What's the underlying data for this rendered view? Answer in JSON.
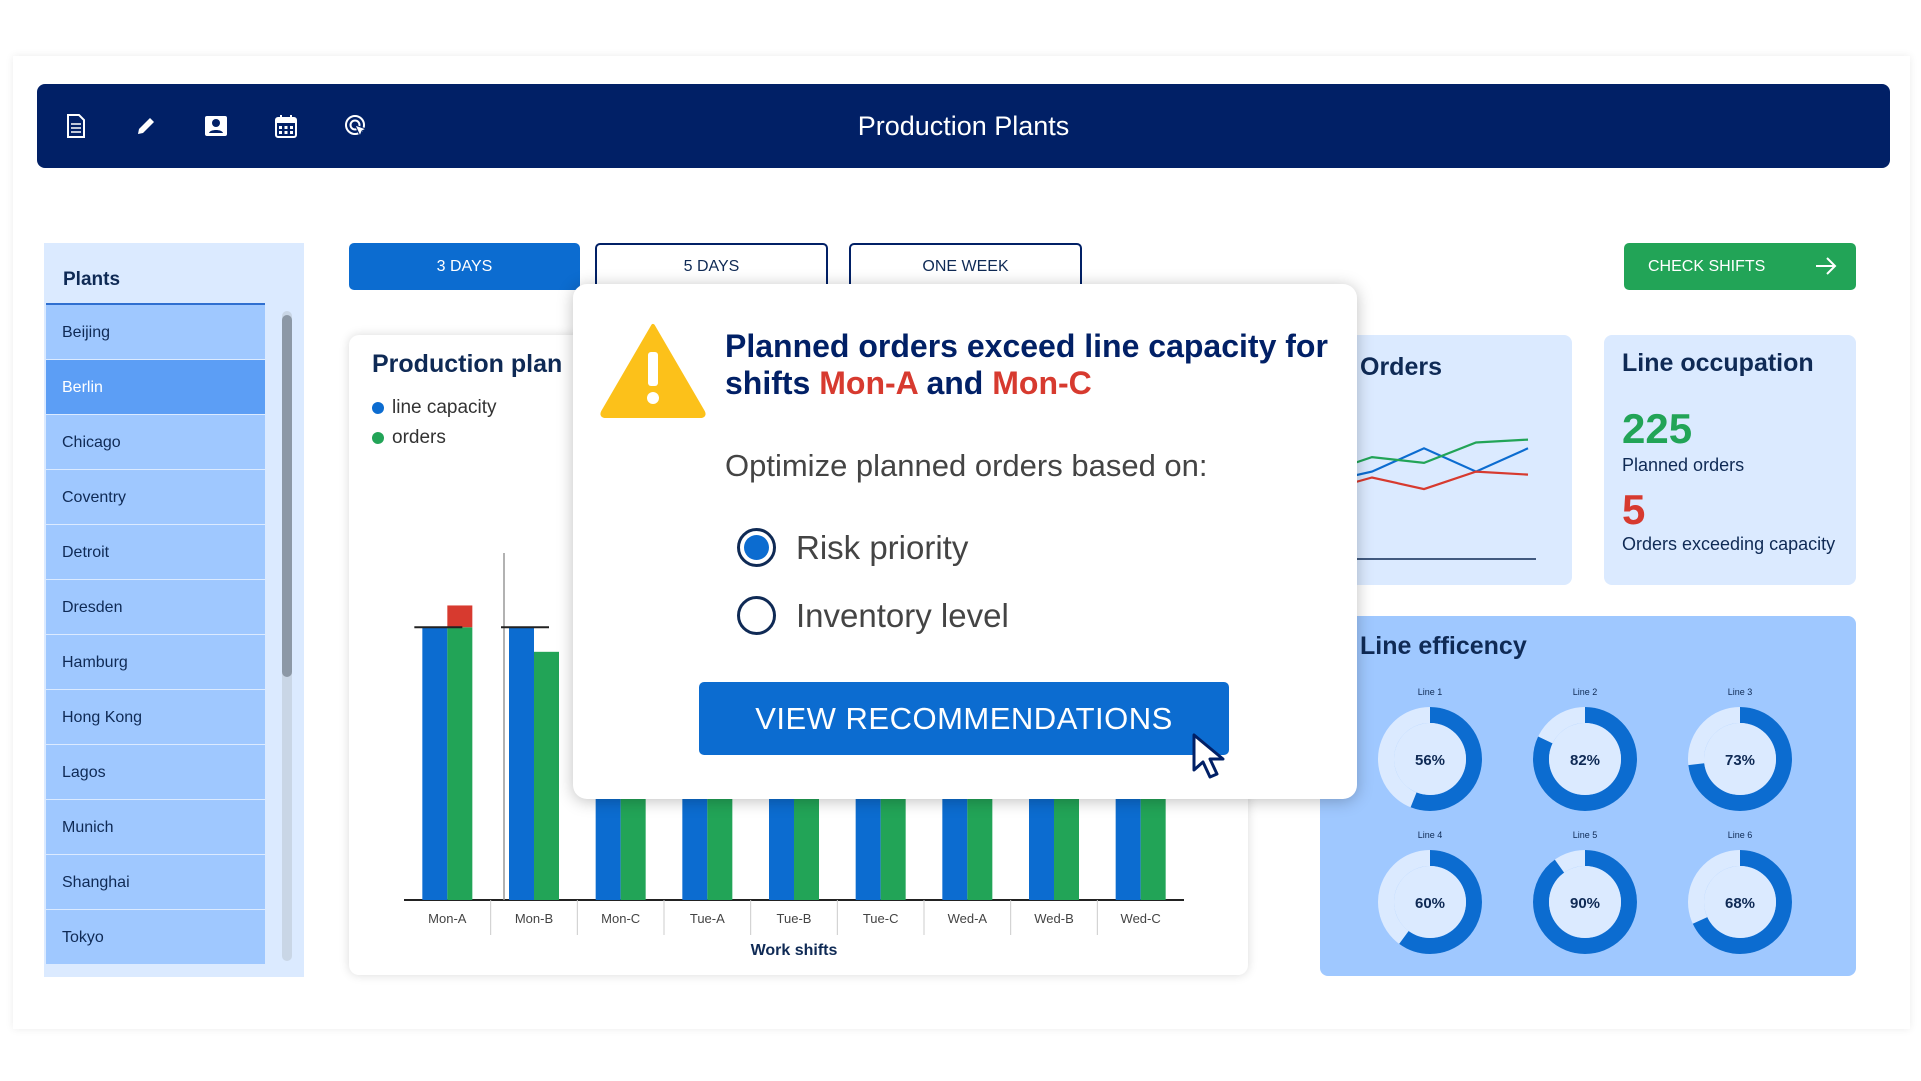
{
  "header": {
    "title": "Production Plants",
    "icons": [
      "document-icon",
      "pencil-icon",
      "contact-card-icon",
      "calendar-icon",
      "target-click-icon"
    ]
  },
  "sidebar": {
    "title": "Plants",
    "items": [
      "Beijing",
      "Berlin",
      "Chicago",
      "Coventry",
      "Detroit",
      "Dresden",
      "Hamburg",
      "Hong Kong",
      "Lagos",
      "Munich",
      "Shanghai",
      "Tokyo"
    ],
    "selected": "Berlin"
  },
  "range_tabs": {
    "three_days": "3 DAYS",
    "five_days": "5 DAYS",
    "one_week": "ONE WEEK",
    "active": "3 DAYS"
  },
  "check_shifts": {
    "label": "CHECK SHIFTS"
  },
  "production_card": {
    "title": "Production plan",
    "legend": {
      "capacity": "line capacity",
      "orders": "orders"
    },
    "xlabel": "Work shifts"
  },
  "orders_card": {
    "title": "Orders"
  },
  "occupation_card": {
    "title": "Line occupation",
    "planned_value": "225",
    "planned_label": "Planned orders",
    "exceeding_value": "5",
    "exceeding_label": "Orders exceeding capacity"
  },
  "efficiency_card": {
    "title": "Line efficency"
  },
  "modal": {
    "title_part1": "Planned orders exceed line capacity for shifts ",
    "shift_a": "Mon-A",
    "title_and": " and ",
    "shift_b": "Mon-C",
    "subtitle": "Optimize planned orders based on:",
    "option_risk": "Risk priority",
    "option_inventory": "Inventory level",
    "selected_option": "Risk priority",
    "button_label": "VIEW RECOMMENDATIONS"
  },
  "colors": {
    "navy": "#012066",
    "blue": "#0c6cd0",
    "green": "#22a457",
    "red": "#d73a2f",
    "light_blue": "#dbeaff",
    "mid_blue": "#9fc8ff"
  },
  "chart_data": [
    {
      "type": "bar",
      "title": "Production plan",
      "xlabel": "Work shifts",
      "categories": [
        "Mon-A",
        "Mon-B",
        "Mon-C",
        "Tue-A",
        "Tue-B",
        "Tue-C",
        "Wed-A",
        "Wed-B",
        "Wed-C"
      ],
      "series": [
        {
          "name": "line capacity",
          "values": [
            100,
            100,
            100,
            100,
            100,
            100,
            100,
            100,
            100
          ]
        },
        {
          "name": "orders",
          "values": [
            108,
            91,
            104,
            93,
            90,
            92,
            89,
            88,
            90
          ]
        }
      ],
      "capacity_limit": 100,
      "ylim": [
        0,
        110
      ]
    },
    {
      "type": "line",
      "title": "Orders",
      "series": [
        {
          "name": "blue",
          "values": [
            52,
            60,
            76,
            60,
            76
          ]
        },
        {
          "name": "green",
          "values": [
            58,
            70,
            66,
            80,
            82
          ]
        },
        {
          "name": "red",
          "values": [
            46,
            56,
            48,
            60,
            58
          ]
        }
      ],
      "ylim": [
        0,
        100
      ]
    },
    {
      "type": "pie",
      "title": "Line efficency",
      "slices": [
        {
          "label": "Line 1",
          "value": 56,
          "text": "56%"
        },
        {
          "label": "Line 2",
          "value": 82,
          "text": "82%"
        },
        {
          "label": "Line 3",
          "value": 73,
          "text": "73%"
        },
        {
          "label": "Line 4",
          "value": 60,
          "text": "60%"
        },
        {
          "label": "Line 5",
          "value": 90,
          "text": "90%"
        },
        {
          "label": "Line 6",
          "value": 68,
          "text": "68%"
        }
      ]
    }
  ]
}
